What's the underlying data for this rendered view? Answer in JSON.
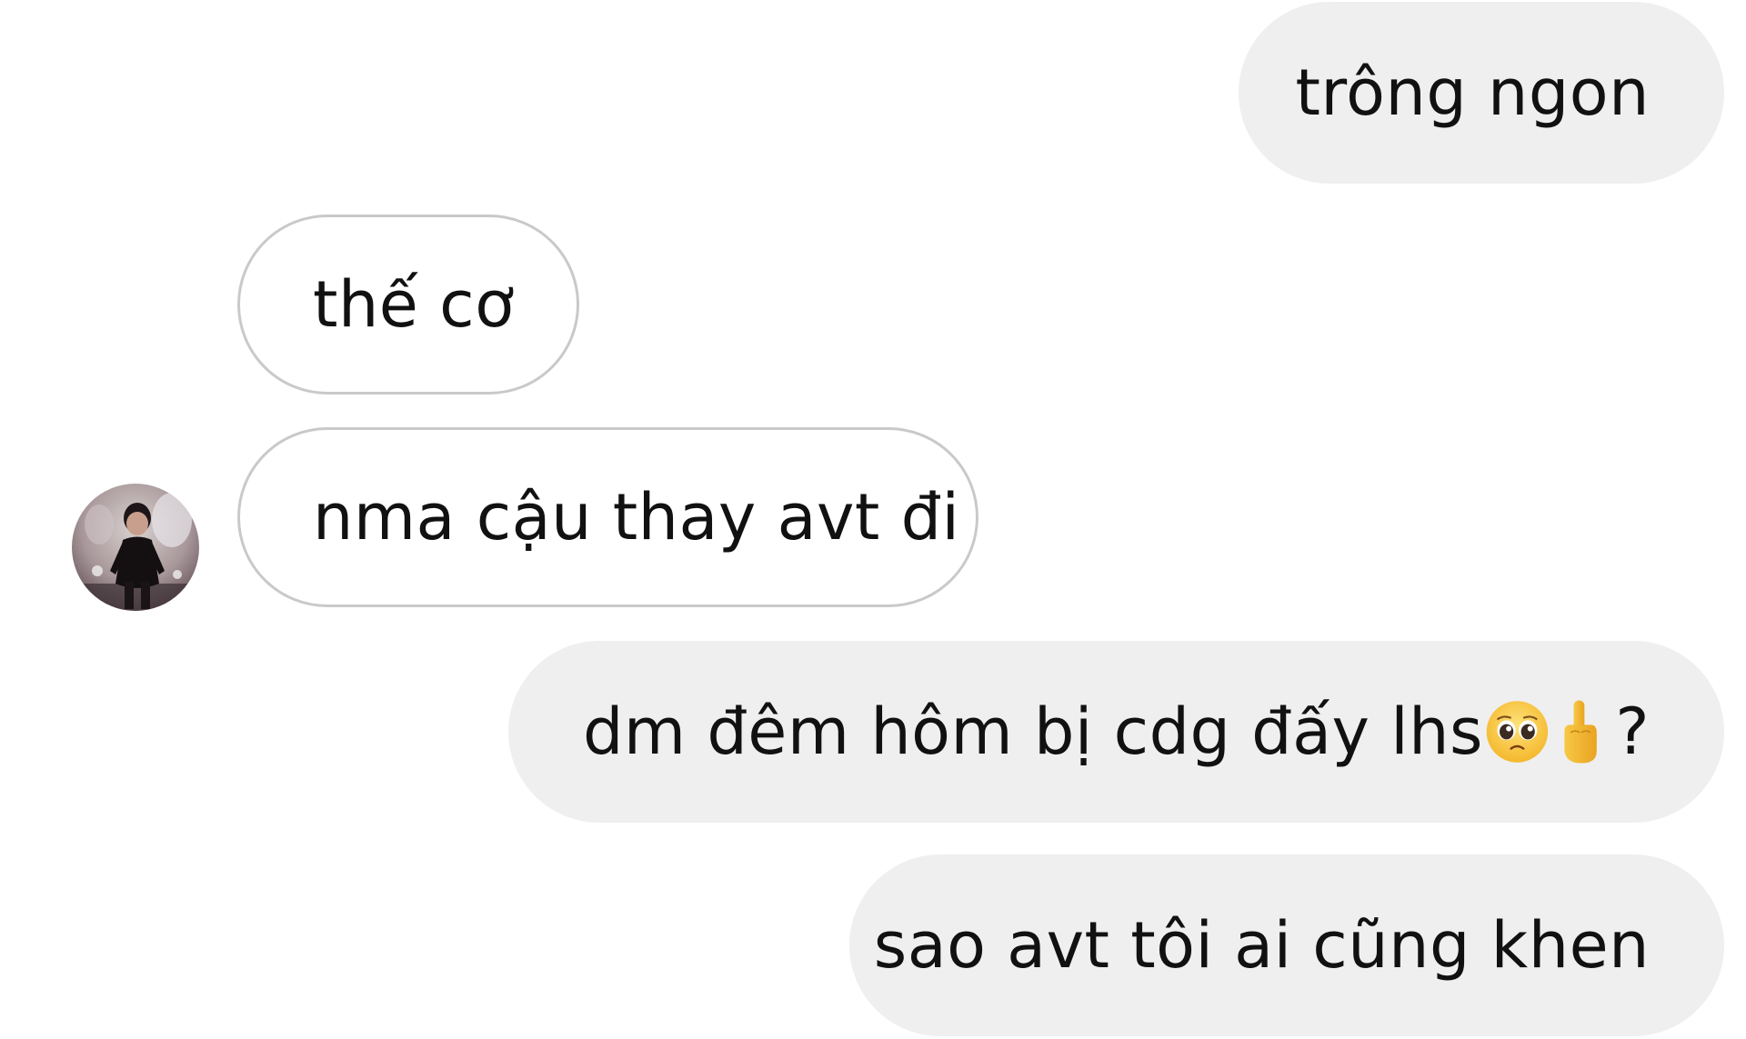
{
  "conversation": {
    "messages": [
      {
        "sender": "me",
        "text": "trông ngon"
      },
      {
        "sender": "other",
        "text": "thế cơ"
      },
      {
        "sender": "other",
        "text": "nma cậu thay avt đi"
      },
      {
        "sender": "me",
        "text": "dm đêm hôm bị cdg đấy lhs",
        "trailing_emojis": [
          "pleading-face-icon",
          "middle-finger-icon"
        ],
        "trailing_text": "?"
      },
      {
        "sender": "me",
        "text": "sao avt tôi ai cũng khen"
      }
    ]
  },
  "colors": {
    "background": "#ffffff",
    "sent_bubble": "#efefef",
    "received_bubble_border": "#c9c9c9",
    "text": "#111111"
  }
}
